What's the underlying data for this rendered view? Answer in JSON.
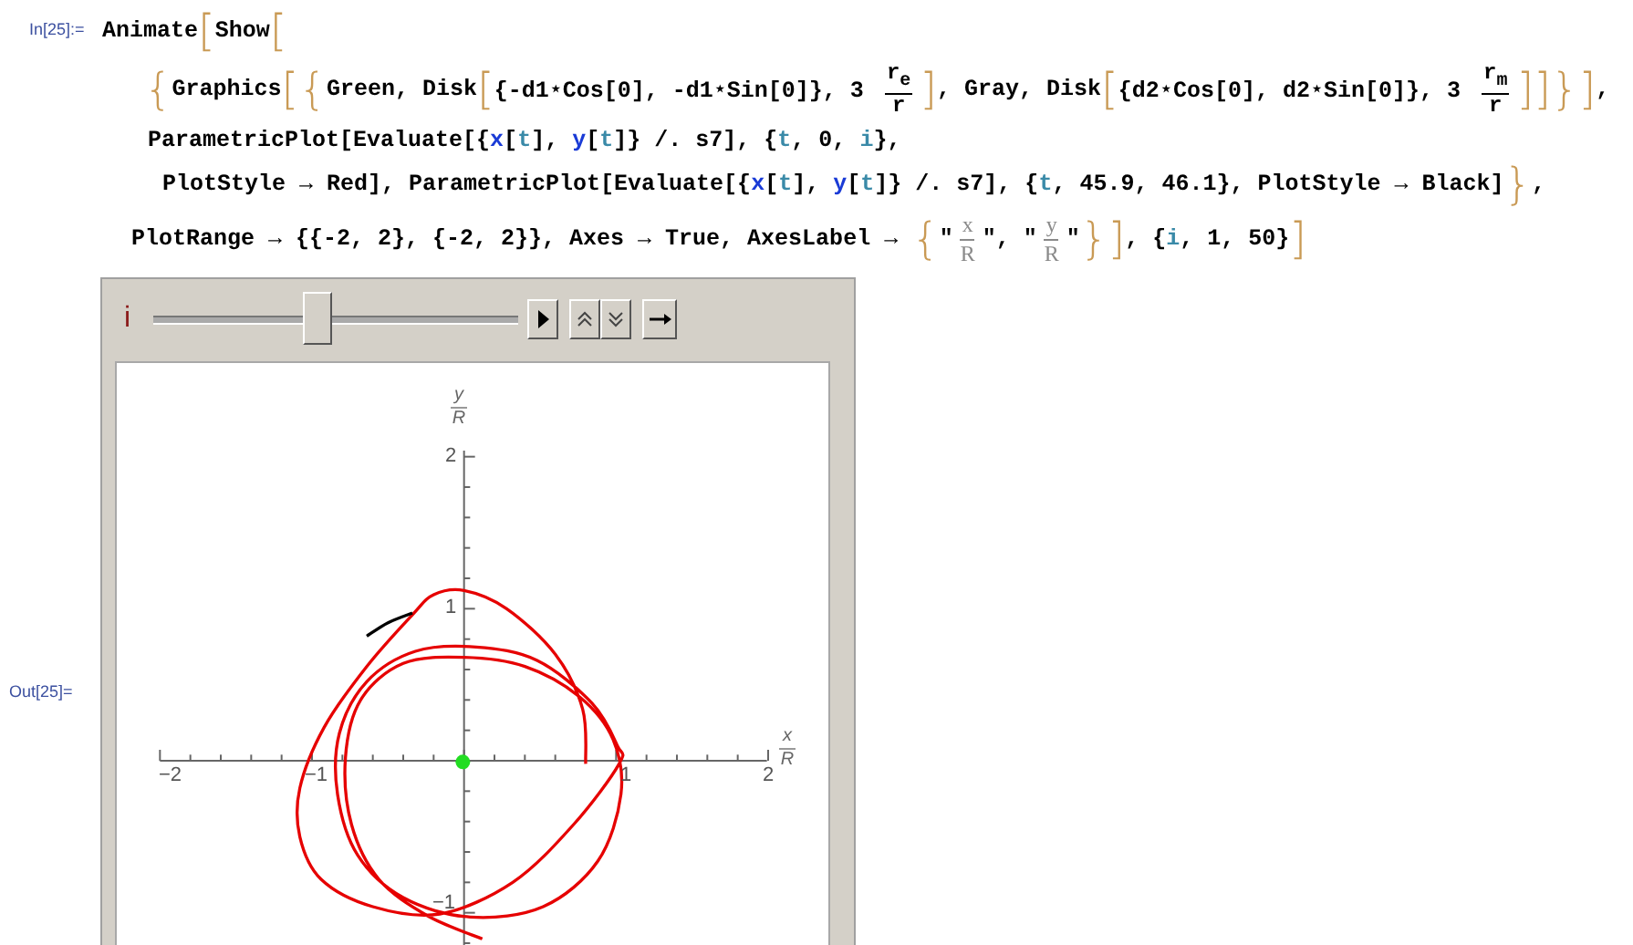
{
  "input_cell": {
    "label": "In[25]:=",
    "lines": [
      [
        {
          "kind": "text",
          "text": "Animate"
        },
        {
          "kind": "bracket",
          "text": "["
        },
        {
          "kind": "text",
          "text": "Show"
        },
        {
          "kind": "bracket",
          "text": "["
        }
      ],
      [
        {
          "kind": "bracket",
          "text": "{"
        },
        {
          "kind": "text",
          "text": "Graphics"
        },
        {
          "kind": "bracket",
          "text": "["
        },
        {
          "kind": "bracket",
          "text": "{"
        },
        {
          "kind": "text",
          "text": "Green, Disk"
        },
        {
          "kind": "bracket",
          "text": "["
        },
        {
          "kind": "text",
          "text": "{-d1⋆Cos[0], -d1⋆Sin[0]}, 3 "
        },
        {
          "kind": "fraction",
          "num": "r$_{e}$",
          "den": "r"
        },
        {
          "kind": "bracket",
          "text": "]"
        },
        {
          "kind": "text",
          "text": ", Gray, Disk"
        },
        {
          "kind": "bracket",
          "text": "["
        },
        {
          "kind": "text",
          "text": "{d2⋆Cos[0], d2⋆Sin[0]}, 3 "
        },
        {
          "kind": "fraction",
          "num": "r$_{m}$",
          "den": "r"
        },
        {
          "kind": "bracket",
          "text": "]"
        },
        {
          "kind": "bracket",
          "text": "]"
        },
        {
          "kind": "bracket",
          "text": "}"
        },
        {
          "kind": "bracket",
          "text": "]"
        },
        {
          "kind": "text",
          "text": ","
        }
      ],
      [
        {
          "kind": "text",
          "text": "ParametricPlot[Evaluate[{"
        },
        {
          "kind": "symbol",
          "text": "x"
        },
        {
          "kind": "text",
          "text": "["
        },
        {
          "kind": "variable",
          "text": "t"
        },
        {
          "kind": "text",
          "text": "], "
        },
        {
          "kind": "symbol",
          "text": "y"
        },
        {
          "kind": "text",
          "text": "["
        },
        {
          "kind": "variable",
          "text": "t"
        },
        {
          "kind": "text",
          "text": "]} /. s7], {"
        },
        {
          "kind": "variable",
          "text": "t"
        },
        {
          "kind": "text",
          "text": ", 0, "
        },
        {
          "kind": "variable",
          "text": "i"
        },
        {
          "kind": "text",
          "text": "},"
        }
      ],
      [
        {
          "kind": "text",
          "text": "PlotStyle → Red], ParametricPlot[Evaluate[{"
        },
        {
          "kind": "symbol",
          "text": "x"
        },
        {
          "kind": "text",
          "text": "["
        },
        {
          "kind": "variable",
          "text": "t"
        },
        {
          "kind": "text",
          "text": "], "
        },
        {
          "kind": "symbol",
          "text": "y"
        },
        {
          "kind": "text",
          "text": "["
        },
        {
          "kind": "variable",
          "text": "t"
        },
        {
          "kind": "text",
          "text": "]} /. s7], {"
        },
        {
          "kind": "variable",
          "text": "t"
        },
        {
          "kind": "text",
          "text": ", 45.9, 46.1}, PlotStyle → Black]"
        },
        {
          "kind": "bracket",
          "text": "}"
        },
        {
          "kind": "text",
          "text": ","
        }
      ],
      [
        {
          "kind": "text",
          "text": "PlotRange → {{-2, 2}, {-2, 2}}, Axes → True, AxesLabel → "
        },
        {
          "kind": "bracket",
          "text": "{"
        },
        {
          "kind": "text",
          "text": "\""
        },
        {
          "kind": "label_fraction",
          "num": "x",
          "den": "R"
        },
        {
          "kind": "text",
          "text": "\", \""
        },
        {
          "kind": "label_fraction",
          "num": "y",
          "den": "R"
        },
        {
          "kind": "text",
          "text": "\""
        },
        {
          "kind": "bracket",
          "text": "}"
        },
        {
          "kind": "bracket",
          "text": "]"
        },
        {
          "kind": "text",
          "text": ", {"
        },
        {
          "kind": "variable",
          "text": "i"
        },
        {
          "kind": "text",
          "text": ", 1, 50}"
        },
        {
          "kind": "bracket",
          "text": "]"
        }
      ]
    ]
  },
  "output_cell": {
    "label": "Out[25]=",
    "animator": {
      "variable": "i",
      "slider": {
        "level": 0.45
      },
      "buttons": [
        {
          "kind": "play"
        },
        {
          "kind": "faster"
        },
        {
          "kind": "slower"
        },
        {
          "kind": "direction"
        }
      ]
    },
    "plot": {
      "x_label": {
        "num": "x",
        "den": "R"
      },
      "y_label": {
        "num": "y",
        "den": "R"
      },
      "x_ticks": [
        "−2",
        "−1",
        "1",
        "2"
      ],
      "y_ticks": [
        "2",
        "1",
        "−1"
      ]
    }
  }
}
